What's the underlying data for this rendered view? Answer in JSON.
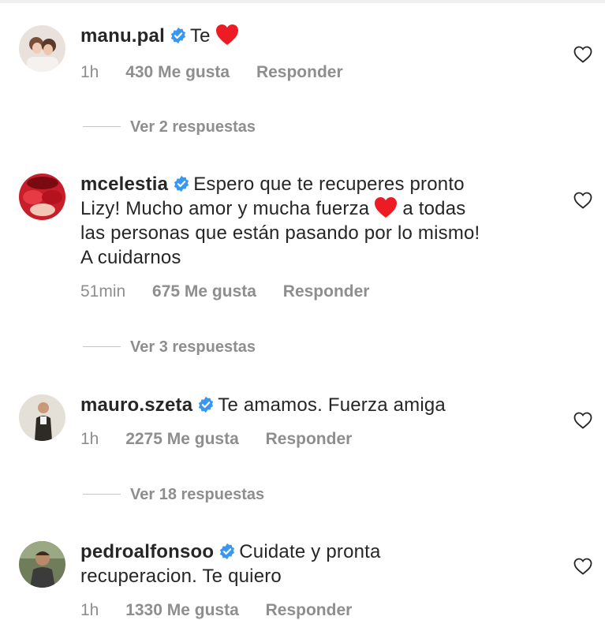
{
  "comments": [
    {
      "username": "manu.pal",
      "text": "Te",
      "emoji": "heart-emoji",
      "time": "1h",
      "likes": "430 Me gusta",
      "reply": "Responder"
    },
    {
      "username": "mcelestia",
      "text_lines": [
        "Espero que te recuperes pronto",
        "Lizy! Mucho amor y mucha fuerza",
        "a todas",
        "las personas que están pasando por lo mismo!",
        "A cuidarnos"
      ],
      "emoji": "heart-emoji",
      "time": "51min",
      "likes": "675 Me gusta",
      "reply": "Responder"
    },
    {
      "username": "mauro.szeta",
      "text": "Te amamos. Fuerza amiga",
      "time": "1h",
      "likes": "2275 Me gusta",
      "reply": "Responder"
    },
    {
      "username": "pedroalfonsoo",
      "text_lines": [
        "Cuidate y pronta",
        "recuperacion. Te quiero"
      ],
      "time": "1h",
      "likes": "1330 Me gusta",
      "reply": "Responder"
    }
  ],
  "view_replies": [
    "Ver 2 respuestas",
    "Ver 3 respuestas",
    "Ver 18 respuestas"
  ],
  "colors": {
    "verified": "#3897f0",
    "heart": "#ed1c24",
    "muted": "#8e8e8e",
    "text": "#262626"
  }
}
